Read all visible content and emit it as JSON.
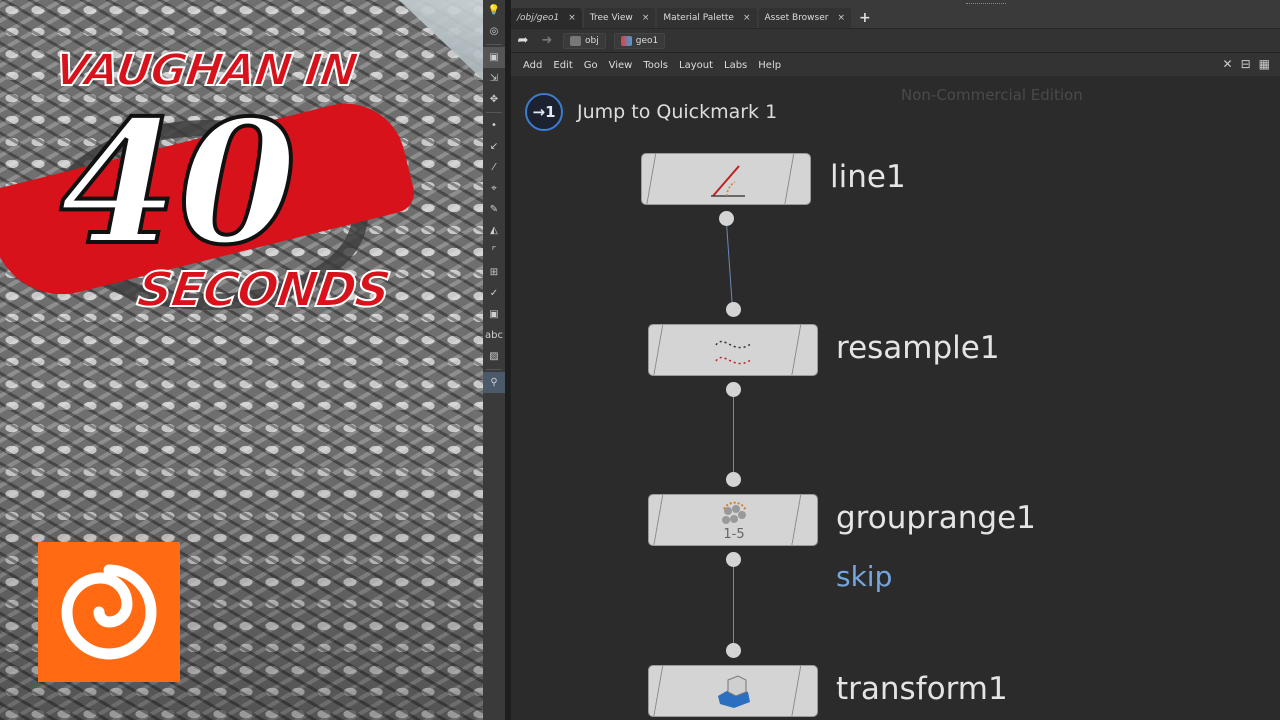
{
  "brand": {
    "line1": "VAUGHAN IN",
    "number": "40",
    "line2": "SECONDS"
  },
  "tabs": [
    {
      "label": "/obj/geo1",
      "active": true
    },
    {
      "label": "Tree View",
      "active": false
    },
    {
      "label": "Material Palette",
      "active": false
    },
    {
      "label": "Asset Browser",
      "active": false
    }
  ],
  "pathbar": {
    "crumbs": [
      "obj",
      "geo1"
    ]
  },
  "menubar": {
    "items": [
      "Add",
      "Edit",
      "Go",
      "View",
      "Tools",
      "Layout",
      "Labs",
      "Help"
    ]
  },
  "network": {
    "watermark": "Non-Commercial Edition",
    "quickmark_label": "Jump to Quickmark 1",
    "quickmark_badge": "1",
    "nodes": [
      {
        "name": "line1",
        "icon": "line-sop-icon"
      },
      {
        "name": "resample1",
        "icon": "resample-sop-icon"
      },
      {
        "name": "grouprange1",
        "icon": "grouprange-sop-icon"
      },
      {
        "name": "transform1",
        "icon": "transform-sop-icon"
      }
    ],
    "annotation": "skip",
    "grouprange_icon_text": "1-5"
  },
  "colors": {
    "brand_red": "#d8121b",
    "houdini_orange": "#ff6a13",
    "wire_blue": "#6e86b8",
    "annotation_blue": "#74a6e0",
    "quickmark_blue": "#3b7bd0"
  }
}
